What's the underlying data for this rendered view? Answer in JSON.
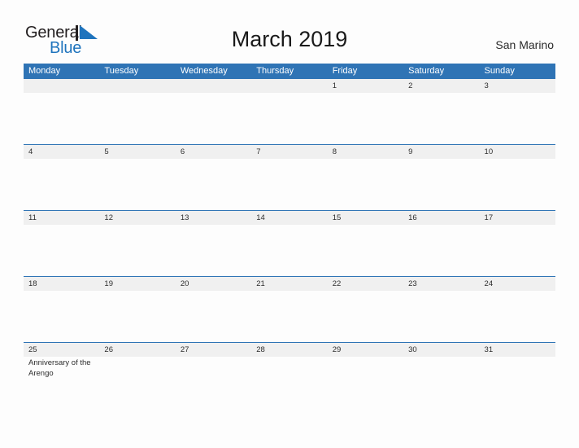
{
  "brand": {
    "name_part1": "General",
    "name_part2": "Blue",
    "flag_icon": "blue-triangle-flag-icon",
    "color_dark": "#231f20",
    "color_blue": "#1f74bd"
  },
  "header": {
    "title": "March 2019",
    "region": "San Marino"
  },
  "theme": {
    "header_blue": "#2f74b5",
    "band_gray": "#f0f0f0",
    "page_background": "#fdfdfd",
    "text_color": "#2d2d2d"
  },
  "calendar": {
    "month": "March",
    "year": "2019",
    "weekday_headers": [
      "Monday",
      "Tuesday",
      "Wednesday",
      "Thursday",
      "Friday",
      "Saturday",
      "Sunday"
    ],
    "weeks": [
      {
        "days": [
          {
            "num": "",
            "events": []
          },
          {
            "num": "",
            "events": []
          },
          {
            "num": "",
            "events": []
          },
          {
            "num": "",
            "events": []
          },
          {
            "num": "1",
            "events": []
          },
          {
            "num": "2",
            "events": []
          },
          {
            "num": "3",
            "events": []
          }
        ]
      },
      {
        "days": [
          {
            "num": "4",
            "events": []
          },
          {
            "num": "5",
            "events": []
          },
          {
            "num": "6",
            "events": []
          },
          {
            "num": "7",
            "events": []
          },
          {
            "num": "8",
            "events": []
          },
          {
            "num": "9",
            "events": []
          },
          {
            "num": "10",
            "events": []
          }
        ]
      },
      {
        "days": [
          {
            "num": "11",
            "events": []
          },
          {
            "num": "12",
            "events": []
          },
          {
            "num": "13",
            "events": []
          },
          {
            "num": "14",
            "events": []
          },
          {
            "num": "15",
            "events": []
          },
          {
            "num": "16",
            "events": []
          },
          {
            "num": "17",
            "events": []
          }
        ]
      },
      {
        "days": [
          {
            "num": "18",
            "events": []
          },
          {
            "num": "19",
            "events": []
          },
          {
            "num": "20",
            "events": []
          },
          {
            "num": "21",
            "events": []
          },
          {
            "num": "22",
            "events": []
          },
          {
            "num": "23",
            "events": []
          },
          {
            "num": "24",
            "events": []
          }
        ]
      },
      {
        "days": [
          {
            "num": "25",
            "events": [
              "Anniversary of the Arengo"
            ]
          },
          {
            "num": "26",
            "events": []
          },
          {
            "num": "27",
            "events": []
          },
          {
            "num": "28",
            "events": []
          },
          {
            "num": "29",
            "events": []
          },
          {
            "num": "30",
            "events": []
          },
          {
            "num": "31",
            "events": []
          }
        ]
      }
    ]
  }
}
